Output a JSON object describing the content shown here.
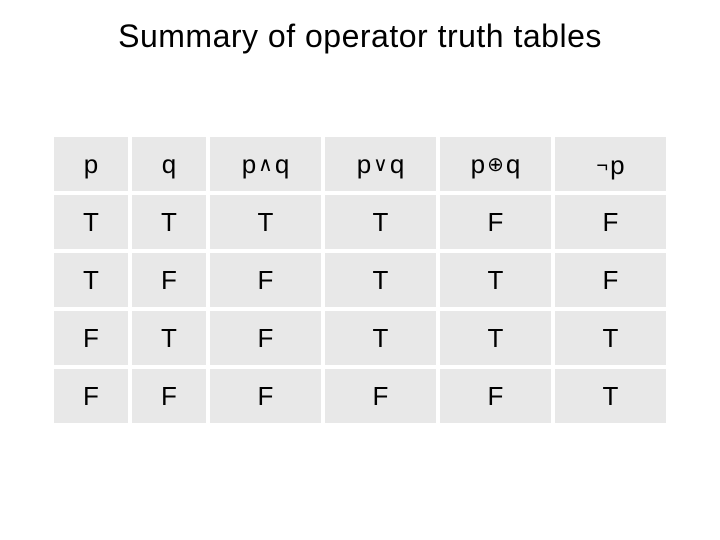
{
  "title": "Summary of operator truth tables",
  "vars": {
    "p": "p",
    "q": "q"
  },
  "ops": {
    "and": "∧",
    "or": "∨",
    "xor": "⊕",
    "not": "¬"
  },
  "headers": {
    "c0_aria": "p",
    "c1_aria": "q",
    "c2_aria": "p and q",
    "c3_aria": "p or q",
    "c4_aria": "p xor q",
    "c5_aria": "not p"
  },
  "chart_data": {
    "type": "table",
    "title": "Summary of operator truth tables",
    "columns": [
      "p",
      "q",
      "p ∧ q",
      "p ∨ q",
      "p ⊕ q",
      "¬p"
    ],
    "rows": [
      [
        "T",
        "T",
        "T",
        "T",
        "F",
        "F"
      ],
      [
        "T",
        "F",
        "F",
        "T",
        "T",
        "F"
      ],
      [
        "F",
        "T",
        "F",
        "T",
        "T",
        "T"
      ],
      [
        "F",
        "F",
        "F",
        "F",
        "F",
        "T"
      ]
    ]
  }
}
